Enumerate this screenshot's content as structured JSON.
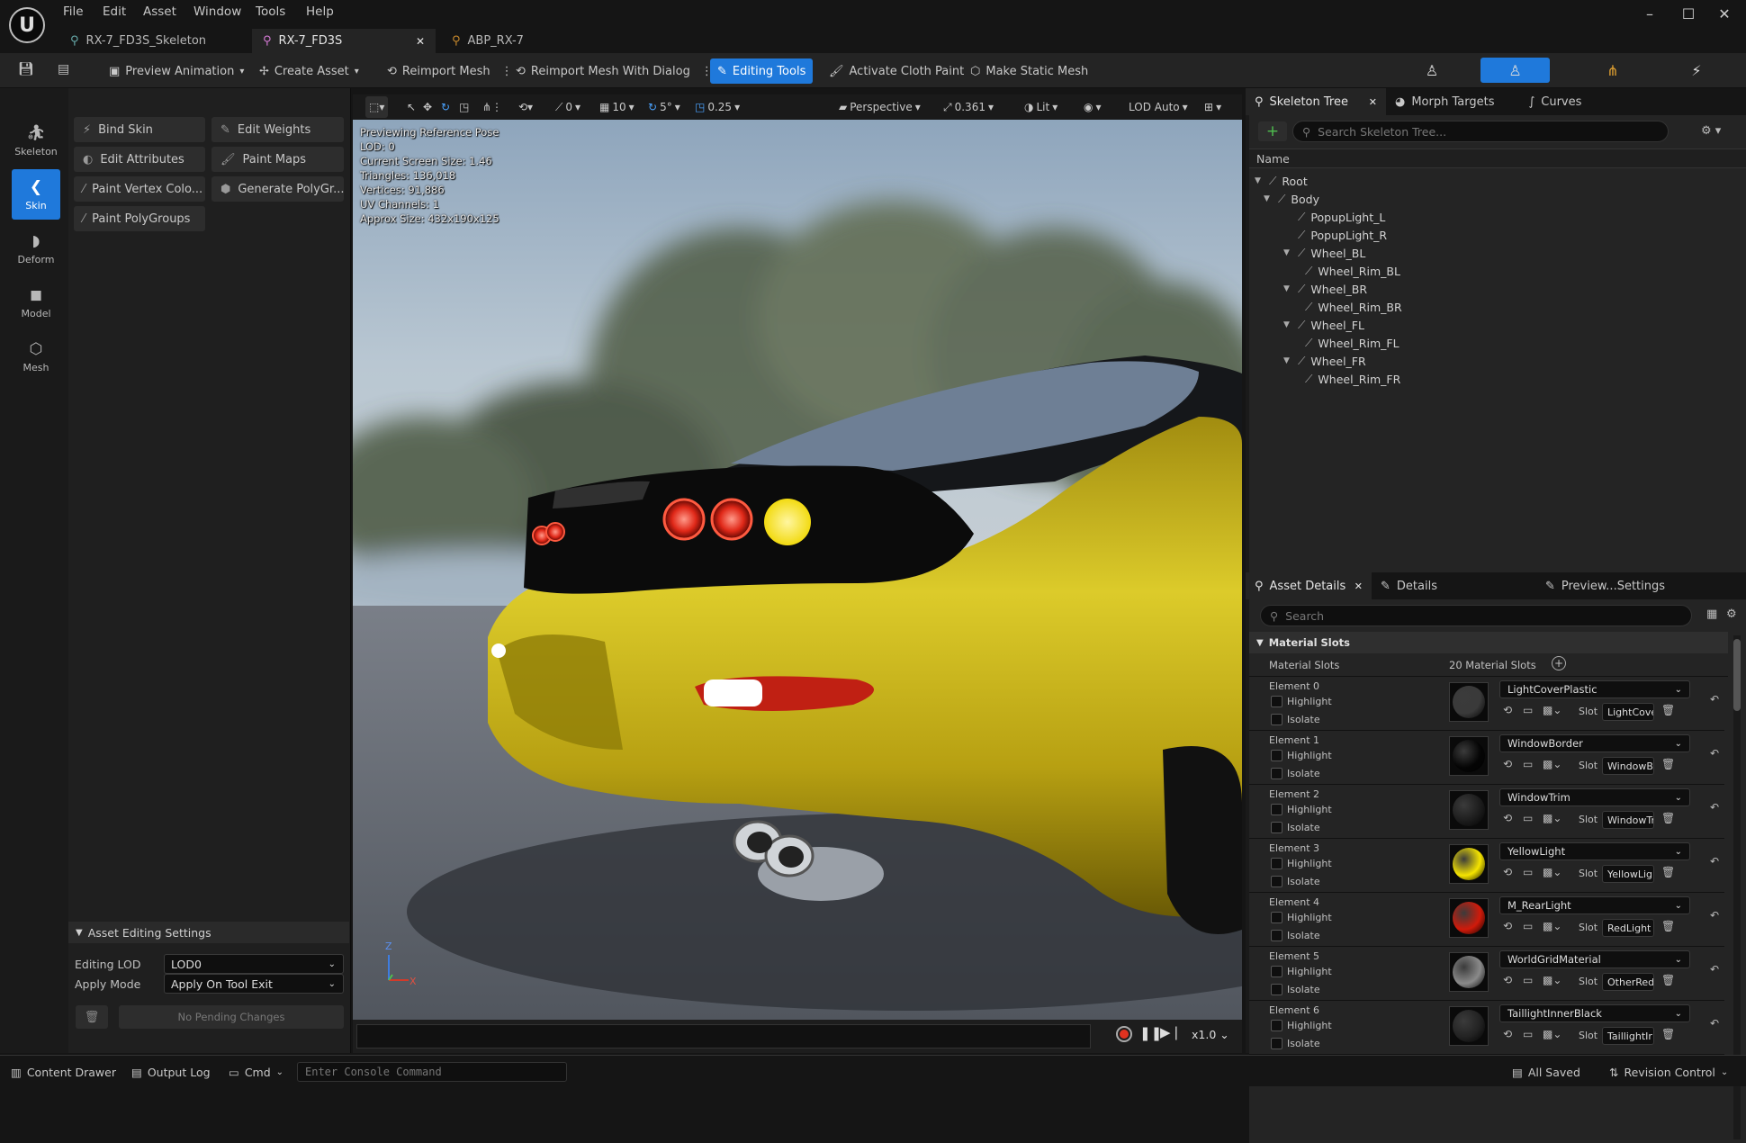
{
  "menu": [
    "File",
    "Edit",
    "Asset",
    "Window",
    "Tools",
    "Help"
  ],
  "tabs": [
    {
      "label": "RX-7_FD3S_Skeleton",
      "active": false
    },
    {
      "label": "RX-7_FD3S",
      "active": true
    },
    {
      "label": "ABP_RX-7",
      "active": false
    }
  ],
  "toolbar": {
    "preview_animation": "Preview Animation",
    "create_asset": "Create Asset",
    "reimport_mesh": "Reimport Mesh",
    "reimport_mesh_dialog": "Reimport Mesh With Dialog",
    "editing_tools": "Editing Tools",
    "activate_cloth_paint": "Activate Cloth Paint",
    "make_static_mesh": "Make Static Mesh"
  },
  "modes": [
    {
      "label": "Skeleton",
      "icon": "skeleton-icon"
    },
    {
      "label": "Skin",
      "icon": "skin-icon",
      "active": true
    },
    {
      "label": "Deform",
      "icon": "deform-icon"
    },
    {
      "label": "Model",
      "icon": "model-icon"
    },
    {
      "label": "Mesh",
      "icon": "mesh-icon"
    }
  ],
  "tools": [
    "Bind Skin",
    "Edit Weights",
    "Edit Attributes",
    "Paint Maps",
    "Paint Vertex Colo...",
    "Generate PolyGr...",
    "Paint PolyGroups"
  ],
  "asset_editing": {
    "header": "Asset Editing Settings",
    "editing_lod_label": "Editing LOD",
    "editing_lod_value": "LOD0",
    "apply_mode_label": "Apply Mode",
    "apply_mode_value": "Apply On Tool Exit",
    "pending": "No Pending Changes"
  },
  "viewport_toolbar": {
    "translate_snap": "0",
    "grid": "10",
    "rotate_snap": "5°",
    "scale_snap": "0.25",
    "perspective": "Perspective",
    "screen": "0.361",
    "lit": "Lit",
    "lod": "LOD Auto"
  },
  "viewport_stats": [
    "Previewing Reference Pose",
    "LOD: 0",
    "Current Screen Size: 1.46",
    "Triangles: 136,018",
    "Vertices: 91,886",
    "UV Channels: 1",
    "Approx Size: 432x190x125"
  ],
  "axis": {
    "z": "Z",
    "x": "X"
  },
  "playback_speed": "x1.0",
  "skeleton_panel": {
    "tabs": [
      "Skeleton Tree",
      "Morph Targets",
      "Curves"
    ],
    "search_placeholder": "Search Skeleton Tree...",
    "column": "Name",
    "bones": [
      {
        "name": "Root",
        "depth": 0
      },
      {
        "name": "Body",
        "depth": 1
      },
      {
        "name": "PopupLight_L",
        "depth": 2
      },
      {
        "name": "PopupLight_R",
        "depth": 2
      },
      {
        "name": "Wheel_BL",
        "depth": 2
      },
      {
        "name": "Wheel_Rim_BL",
        "depth": 3
      },
      {
        "name": "Wheel_BR",
        "depth": 2
      },
      {
        "name": "Wheel_Rim_BR",
        "depth": 3
      },
      {
        "name": "Wheel_FL",
        "depth": 2
      },
      {
        "name": "Wheel_Rim_FL",
        "depth": 3
      },
      {
        "name": "Wheel_FR",
        "depth": 2
      },
      {
        "name": "Wheel_Rim_FR",
        "depth": 3
      }
    ]
  },
  "details_panel": {
    "tabs": [
      "Asset Details",
      "Details",
      "Preview...Settings"
    ],
    "search_placeholder": "Search",
    "section": "Material Slots",
    "slots_label": "Material Slots",
    "slots_count": "20 Material Slots",
    "highlight": "Highlight",
    "isolate": "Isolate",
    "slot_label": "Slot",
    "elements": [
      {
        "label": "Element 0",
        "material": "LightCoverPlastic",
        "slot": "LightCove",
        "thumb": "#3a3a3a"
      },
      {
        "label": "Element 1",
        "material": "WindowBorder",
        "slot": "WindowBo",
        "thumb": "#050505"
      },
      {
        "label": "Element 2",
        "material": "WindowTrim",
        "slot": "WindowTr",
        "thumb": "#1c1c1c"
      },
      {
        "label": "Element 3",
        "material": "YellowLight",
        "slot": "YellowLig",
        "thumb": "#f5e400"
      },
      {
        "label": "Element 4",
        "material": "M_RearLight",
        "slot": "RedLight",
        "thumb": "#d11a0a"
      },
      {
        "label": "Element 5",
        "material": "WorldGridMaterial",
        "slot": "OtherRed",
        "thumb": "#8a8a8a"
      },
      {
        "label": "Element 6",
        "material": "TaillightInnerBlack",
        "slot": "TaillightIr",
        "thumb": "#222222"
      }
    ]
  },
  "statusbar": {
    "content_drawer": "Content Drawer",
    "output_log": "Output Log",
    "cmd": "Cmd",
    "console_placeholder": "Enter Console Command",
    "all_saved": "All Saved",
    "revision_control": "Revision Control"
  },
  "colors": {
    "accent": "#1f79db",
    "car": "#d8c21a",
    "taillight": "#ff3b2a",
    "yellow_light": "#ffe94a"
  }
}
